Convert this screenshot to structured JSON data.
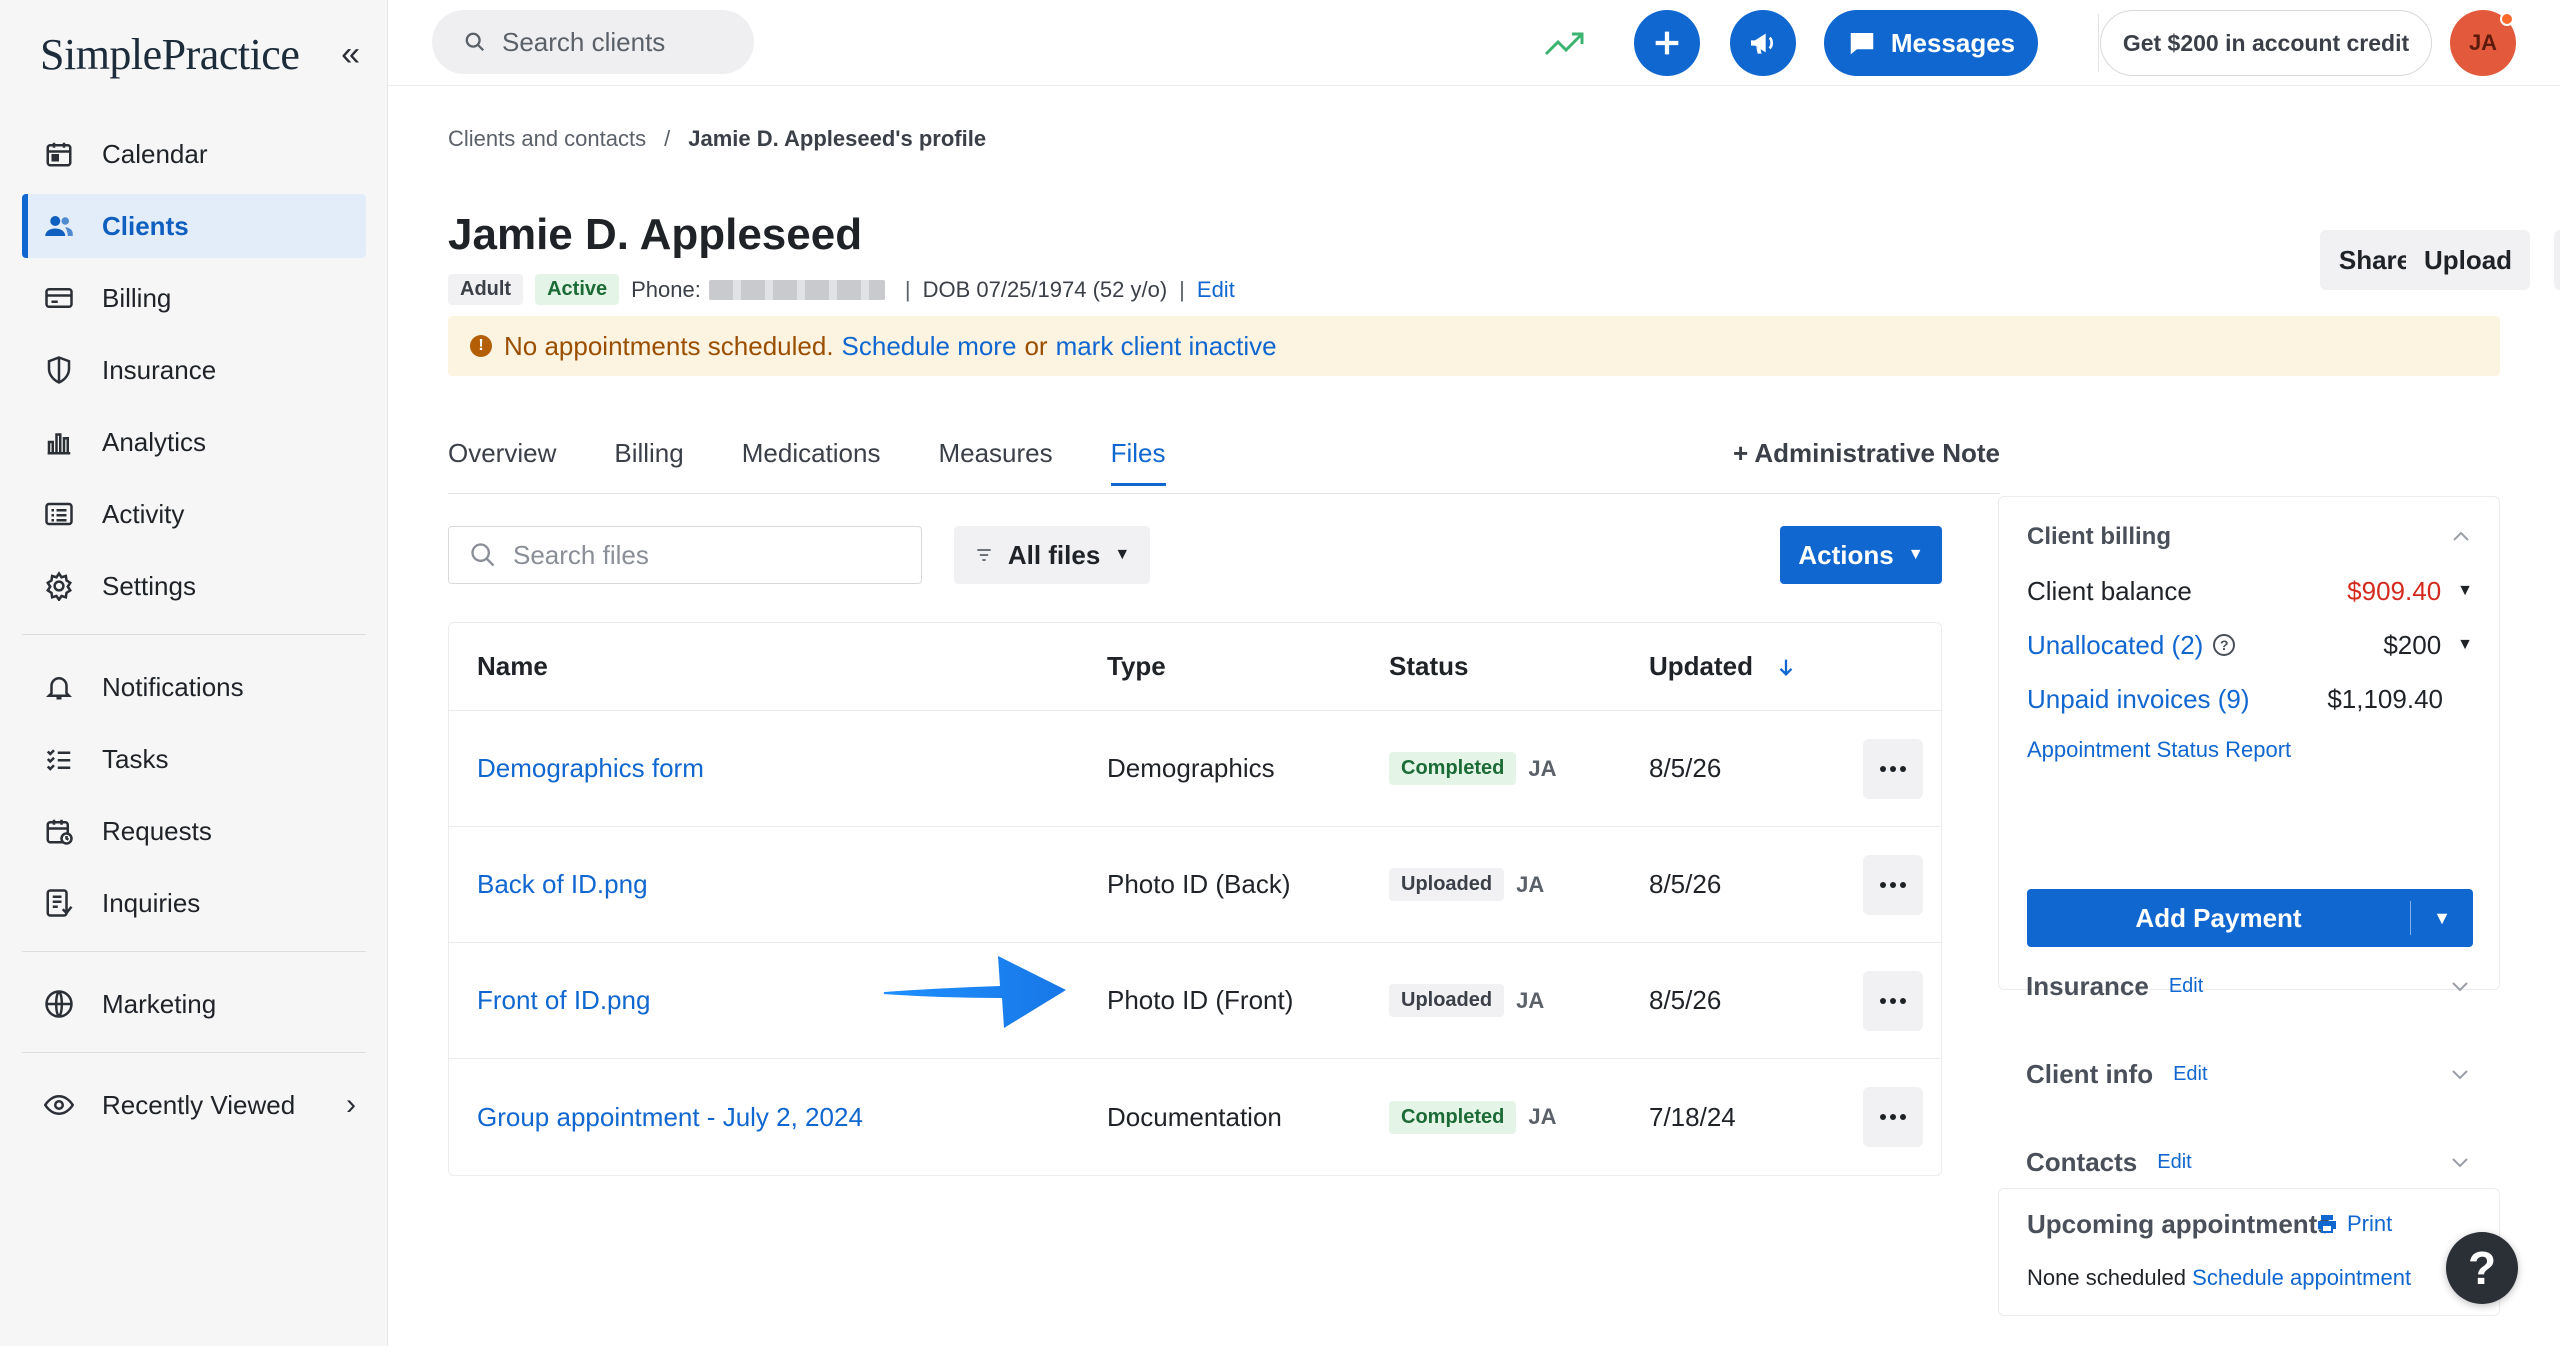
{
  "app": {
    "logo_text": "SimplePractice",
    "collapse_glyph": "«",
    "brand_color": "#1167d0"
  },
  "sidebar": {
    "main_items": [
      {
        "label": "Calendar",
        "icon": "calendar-icon"
      },
      {
        "label": "Clients",
        "icon": "clients-icon",
        "active": true
      },
      {
        "label": "Billing",
        "icon": "billing-icon"
      },
      {
        "label": "Insurance",
        "icon": "shield-icon"
      },
      {
        "label": "Analytics",
        "icon": "analytics-icon"
      },
      {
        "label": "Activity",
        "icon": "activity-icon"
      },
      {
        "label": "Settings",
        "icon": "gear-icon"
      }
    ],
    "secondary_items": [
      {
        "label": "Notifications",
        "icon": "bell-icon"
      },
      {
        "label": "Tasks",
        "icon": "tasks-icon"
      },
      {
        "label": "Requests",
        "icon": "requests-icon"
      },
      {
        "label": "Inquiries",
        "icon": "inquiries-icon"
      }
    ],
    "marketing_label": "Marketing",
    "recently_viewed_label": "Recently Viewed",
    "chevron_glyph": "›"
  },
  "topbar": {
    "search_placeholder": "Search clients",
    "messages_label": "Messages",
    "credit_label": "Get $200 in account credit",
    "avatar_initials": "JA"
  },
  "breadcrumb": {
    "parent": "Clients and contacts",
    "separator": "/",
    "current": "Jamie D. Appleseed's profile"
  },
  "client": {
    "name": "Jamie D. Appleseed",
    "age_group": "Adult",
    "status": "Active",
    "phone_label": "Phone:",
    "dob": "DOB 07/25/1974 (52 y/o)",
    "edit_label": "Edit",
    "meta_separator": "|"
  },
  "header_actions": {
    "share": "Share",
    "upload": "Upload"
  },
  "alert": {
    "icon_glyph": "!",
    "text": "No appointments scheduled.",
    "schedule_link": "Schedule more",
    "or": "or",
    "inactive_link": "mark client inactive"
  },
  "tabs": [
    {
      "label": "Overview"
    },
    {
      "label": "Billing"
    },
    {
      "label": "Medications"
    },
    {
      "label": "Measures"
    },
    {
      "label": "Files",
      "active": true
    }
  ],
  "admin_note_label": "+ Administrative Note",
  "files_toolbar": {
    "search_placeholder": "Search files",
    "filter_label": "All files",
    "actions_label": "Actions",
    "caret_glyph": "▼"
  },
  "files_table": {
    "columns": {
      "name": "Name",
      "type": "Type",
      "status": "Status",
      "updated": "Updated"
    },
    "rows": [
      {
        "name": "Demographics form",
        "type": "Demographics",
        "status": "Completed",
        "status_kind": "completed",
        "by": "JA",
        "updated": "8/5/26"
      },
      {
        "name": "Back of ID.png",
        "type": "Photo ID (Back)",
        "status": "Uploaded",
        "status_kind": "uploaded",
        "by": "JA",
        "updated": "8/5/26"
      },
      {
        "name": "Front of ID.png",
        "type": "Photo ID (Front)",
        "status": "Uploaded",
        "status_kind": "uploaded",
        "by": "JA",
        "updated": "8/5/26"
      },
      {
        "name": "Group appointment - July 2, 2024",
        "type": "Documentation",
        "status": "Completed",
        "status_kind": "completed",
        "by": "JA",
        "updated": "7/18/24"
      }
    ]
  },
  "client_billing": {
    "title": "Client billing",
    "balance_label": "Client balance",
    "balance_value": "$909.40",
    "unallocated_label": "Unallocated (2)",
    "help_glyph": "?",
    "unallocated_value": "$200",
    "unpaid_label": "Unpaid invoices (9)",
    "unpaid_value": "$1,109.40",
    "report_link": "Appointment Status Report",
    "add_payment_label": "Add Payment",
    "caret_glyph": "▼"
  },
  "right_sections": [
    {
      "title": "Insurance",
      "edit": "Edit"
    },
    {
      "title": "Client info",
      "edit": "Edit"
    },
    {
      "title": "Contacts",
      "edit": "Edit"
    }
  ],
  "upcoming": {
    "title": "Upcoming appointments",
    "print_label": "Print",
    "none_text": "None scheduled",
    "schedule_link": "Schedule appointment"
  },
  "help_fab_glyph": "?"
}
